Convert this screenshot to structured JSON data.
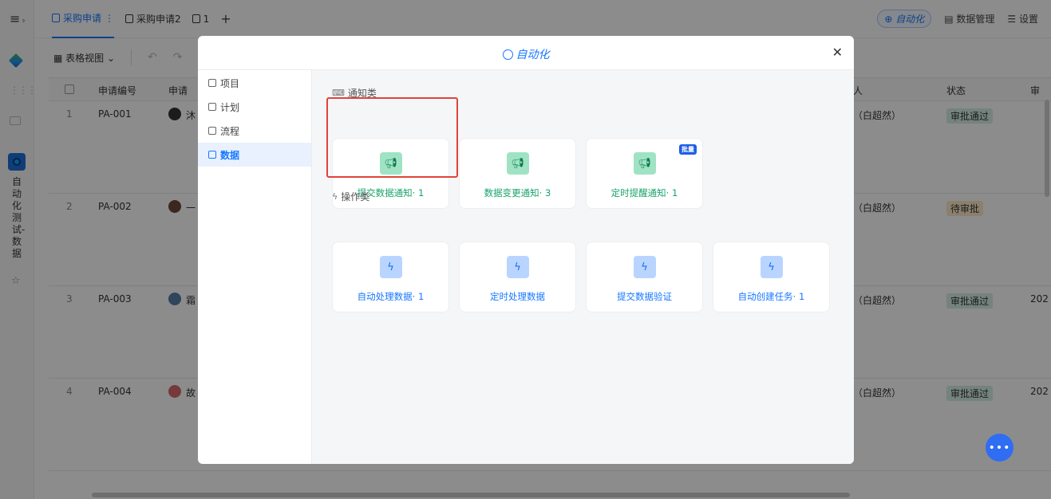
{
  "sidebar": {
    "app_name": "自动化测试-数据"
  },
  "tabs": [
    {
      "label": "采购申请",
      "active": true
    },
    {
      "label": "采购申请2"
    },
    {
      "label": "1"
    }
  ],
  "top_right": {
    "automation": "自动化",
    "data_management": "数据管理",
    "settings": "设置"
  },
  "toolbar": {
    "view_label": "表格视图"
  },
  "table": {
    "columns": [
      "申请编号",
      "申请",
      "人",
      "状态",
      "审"
    ],
    "rows": [
      {
        "num": "1",
        "id": "PA-001",
        "applicant": "沐",
        "person": "（白超然）",
        "status": "审批通过",
        "date": ""
      },
      {
        "num": "2",
        "id": "PA-002",
        "applicant": "一",
        "person": "（白超然）",
        "status": "待审批",
        "date": ""
      },
      {
        "num": "3",
        "id": "PA-003",
        "applicant": "霜",
        "person": "（白超然）",
        "status": "审批通过",
        "date": "202"
      },
      {
        "num": "4",
        "id": "PA-004",
        "applicant": "故",
        "person": "（白超然）",
        "status": "审批通过",
        "date": "202"
      }
    ]
  },
  "modal": {
    "title": "自动化",
    "side_items": [
      {
        "label": "项目"
      },
      {
        "label": "计划"
      },
      {
        "label": "流程"
      },
      {
        "label": "数据",
        "active": true
      }
    ],
    "notify_section": "通知类",
    "notify_cards": [
      {
        "label": "提交数据通知· 1"
      },
      {
        "label": "数据变更通知· 3"
      },
      {
        "label": "定时提醒通知· 1",
        "tag": "批量"
      }
    ],
    "operation_section": "操作类",
    "operation_cards": [
      {
        "label": "自动处理数据· 1"
      },
      {
        "label": "定时处理数据"
      },
      {
        "label": "提交数据验证"
      },
      {
        "label": "自动创建任务· 1"
      }
    ]
  },
  "colors": {
    "accent": "#1677ff",
    "notify_green": "#16a36b",
    "highlight_red": "#e0433a",
    "approved_badge": "#d4efe4",
    "pending_badge": "#fde9c6"
  }
}
